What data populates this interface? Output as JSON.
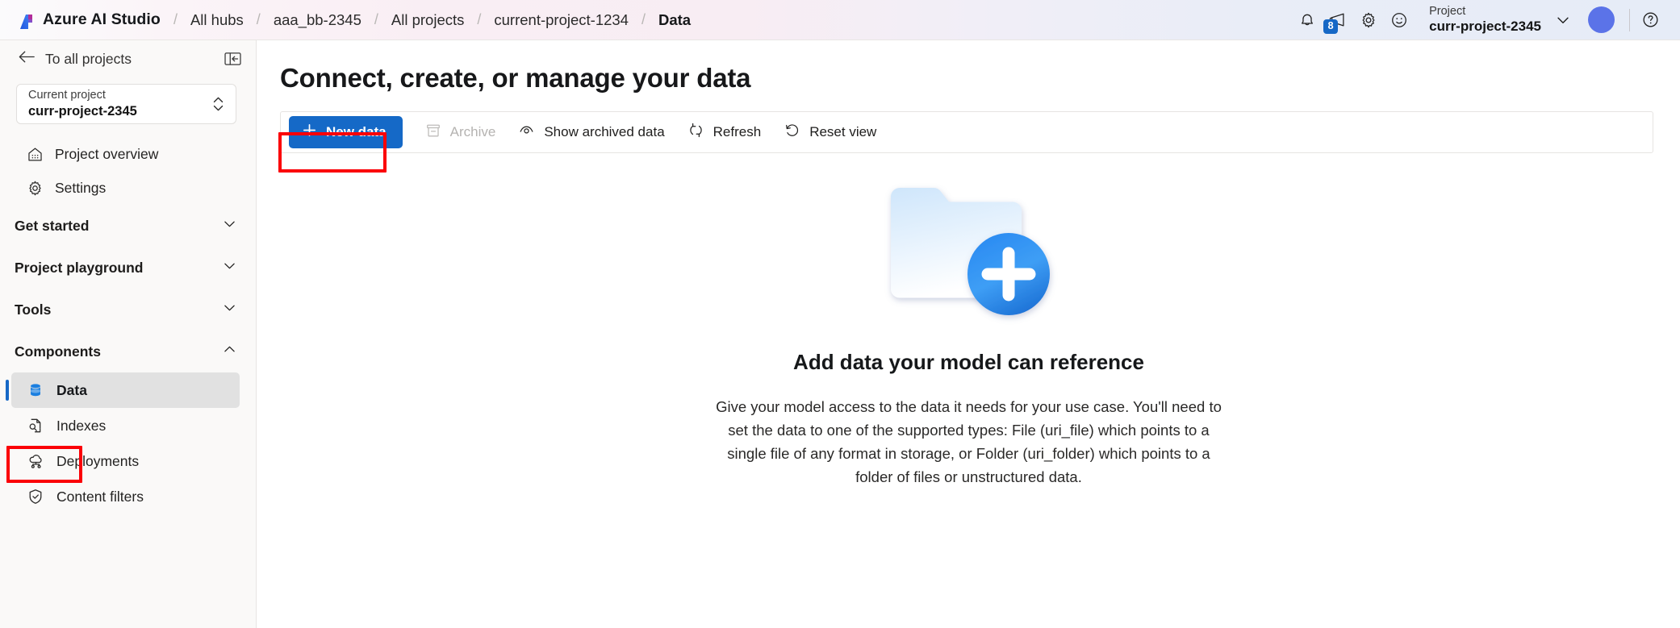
{
  "header": {
    "brand": "Azure AI Studio",
    "brand_logo_icon": "azure-ai-studio-logo",
    "separator": "/",
    "breadcrumbs": [
      {
        "label": "All hubs",
        "current": false
      },
      {
        "label": "aaa_bb-2345",
        "current": false
      },
      {
        "label": "All projects",
        "current": false
      },
      {
        "label": "current-project-1234",
        "current": false
      },
      {
        "label": "Data",
        "current": true
      }
    ],
    "icons": [
      {
        "name": "notifications-bell-icon",
        "badge": null
      },
      {
        "name": "announcements-megaphone-icon",
        "badge": "8"
      },
      {
        "name": "settings-gear-icon",
        "badge": null
      },
      {
        "name": "feedback-smiley-icon",
        "badge": null
      }
    ],
    "project_switcher": {
      "label": "Project",
      "value": "curr-project-2345",
      "chevron_icon": "chevron-down-icon"
    },
    "avatar_icon": "user-avatar",
    "help_icon": "help-question-icon",
    "accent_blue": "#1668c6",
    "avatar_color": "#5b73e8"
  },
  "sidebar": {
    "back_label": "To all projects",
    "back_icon": "arrow-left-icon",
    "collapse_icon": "collapse-panel-icon",
    "project_card": {
      "label": "Current project",
      "value": "curr-project-2345",
      "caret_icon": "chevron-up-down-icon"
    },
    "nav_items": [
      {
        "label": "Project overview",
        "icon": "home-overview-icon"
      },
      {
        "label": "Settings",
        "icon": "gear-icon"
      }
    ],
    "sections": [
      {
        "label": "Get started",
        "icon": "chevron-down-icon",
        "expanded": false
      },
      {
        "label": "Project playground",
        "icon": "chevron-down-icon",
        "expanded": false
      },
      {
        "label": "Tools",
        "icon": "chevron-down-icon",
        "expanded": false
      },
      {
        "label": "Components",
        "icon": "chevron-up-icon",
        "expanded": true
      }
    ],
    "components_items": [
      {
        "label": "Data",
        "icon": "database-icon",
        "selected": true
      },
      {
        "label": "Indexes",
        "icon": "index-search-document-icon",
        "selected": false
      },
      {
        "label": "Deployments",
        "icon": "cloud-deployment-icon",
        "selected": false
      },
      {
        "label": "Content filters",
        "icon": "shield-check-icon",
        "selected": false
      }
    ]
  },
  "main": {
    "page_title": "Connect, create, or manage your data",
    "toolbar": [
      {
        "label": "New data",
        "icon": "plus-icon",
        "style": "primary",
        "disabled": false
      },
      {
        "label": "Archive",
        "icon": "archive-box-icon",
        "style": "default",
        "disabled": true
      },
      {
        "label": "Show archived data",
        "icon": "eye-icon",
        "style": "default",
        "disabled": false
      },
      {
        "label": "Refresh",
        "icon": "refresh-icon",
        "style": "default",
        "disabled": false
      },
      {
        "label": "Reset view",
        "icon": "reset-undo-icon",
        "style": "default",
        "disabled": false
      }
    ],
    "empty_state": {
      "illustration_icon": "folder-plus-illustration",
      "title": "Add data your model can reference",
      "body": "Give your model access to the data it needs for your use case. You'll need to set the data to one of the supported types: File (uri_file) which points to a single file of any format in storage, or Folder (uri_folder) which points to a folder of files or unstructured data."
    }
  },
  "annotations": {
    "color": "#fb0007",
    "boxes": [
      {
        "name": "highlight-new-data-button"
      },
      {
        "name": "highlight-sidebar-data-item"
      }
    ]
  }
}
